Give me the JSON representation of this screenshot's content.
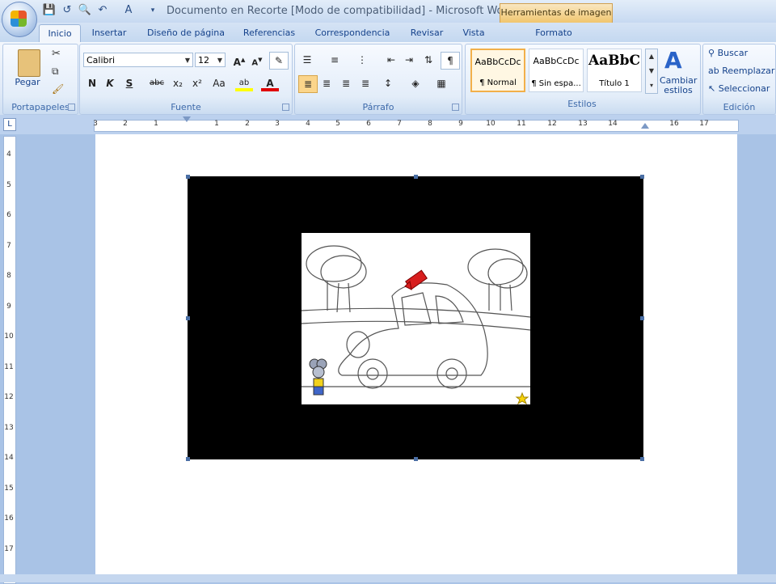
{
  "window": {
    "title": "Documento en Recorte [Modo de compatibilidad] - Microsoft Wo...",
    "contextual_group": "Herramientas de imagen"
  },
  "tabs": [
    "Inicio",
    "Insertar",
    "Diseño de página",
    "Referencias",
    "Correspondencia",
    "Revisar",
    "Vista",
    "Formato"
  ],
  "ribbon": {
    "portapapeles": {
      "label": "Portapapeles",
      "paste": "Pegar"
    },
    "fuente": {
      "label": "Fuente",
      "font_name": "Calibri",
      "font_size": "12",
      "bold": "N",
      "italic": "K",
      "underline": "S",
      "strike": "abc",
      "sub": "x₂",
      "sup": "x²",
      "case": "Aa"
    },
    "parrafo": {
      "label": "Párrafo"
    },
    "estilos": {
      "label": "Estilos",
      "change_styles": "Cambiar estilos",
      "items": [
        {
          "sample": "AaBbCcDc",
          "name": "¶ Normal"
        },
        {
          "sample": "AaBbCcDc",
          "name": "¶ Sin espa..."
        },
        {
          "sample": "AaBbC",
          "name": "Título 1"
        }
      ]
    },
    "edicion": {
      "label": "Edición",
      "find": "Buscar",
      "replace": "Reemplazar",
      "select": "Seleccionar"
    }
  },
  "ruler": {
    "h_numbers": [
      "3",
      "2",
      "1",
      "1",
      "2",
      "3",
      "4",
      "5",
      "6",
      "7",
      "8",
      "9",
      "10",
      "11",
      "12",
      "13",
      "14",
      "16",
      "17"
    ],
    "v_numbers": [
      "4",
      "5",
      "6",
      "7",
      "8",
      "9",
      "10",
      "11",
      "12",
      "13",
      "14",
      "15",
      "16",
      "17"
    ]
  },
  "colors": {
    "accent": "#15428b",
    "ribbon_bg": "#dfe9f7",
    "contextual": "#f0c46a"
  }
}
